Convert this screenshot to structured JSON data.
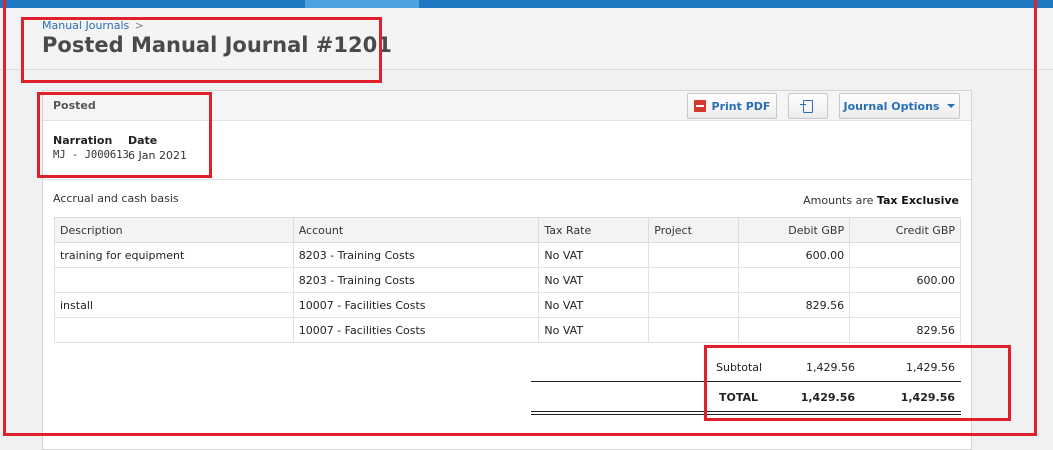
{
  "header": {
    "breadcrumb": "Manual Journals",
    "breadcrumb_sep": ">",
    "title": "Posted Manual Journal #1201"
  },
  "card": {
    "status": "Posted",
    "buttons": {
      "print_pdf": "Print PDF",
      "journal_options": "Journal Options"
    },
    "meta": {
      "narration_label": "Narration",
      "narration_value": "MJ - J000613",
      "date_label": "Date",
      "date_value": "6 Jan 2021"
    },
    "basis": "Accrual and cash basis",
    "amounts_prefix": "Amounts are",
    "amounts_mode": "Tax Exclusive"
  },
  "table": {
    "headers": [
      "Description",
      "Account",
      "Tax Rate",
      "Project",
      "Debit GBP",
      "Credit GBP"
    ],
    "rows": [
      [
        "training for equipment",
        "8203 - Training Costs",
        "No VAT",
        "",
        "600.00",
        ""
      ],
      [
        "",
        "8203 - Training Costs",
        "No VAT",
        "",
        "",
        "600.00"
      ],
      [
        "install",
        "10007 - Facilities Costs",
        "No VAT",
        "",
        "829.56",
        ""
      ],
      [
        "",
        "10007 - Facilities Costs",
        "No VAT",
        "",
        "",
        "829.56"
      ]
    ]
  },
  "totals": {
    "subtotal_label": "Subtotal",
    "subtotal_debit": "1,429.56",
    "subtotal_credit": "1,429.56",
    "total_label": "TOTAL",
    "total_debit": "1,429.56",
    "total_credit": "1,429.56"
  },
  "colors": {
    "accent": "#1f78c1",
    "link": "#2a6fb5",
    "highlight": "#e0202a"
  }
}
